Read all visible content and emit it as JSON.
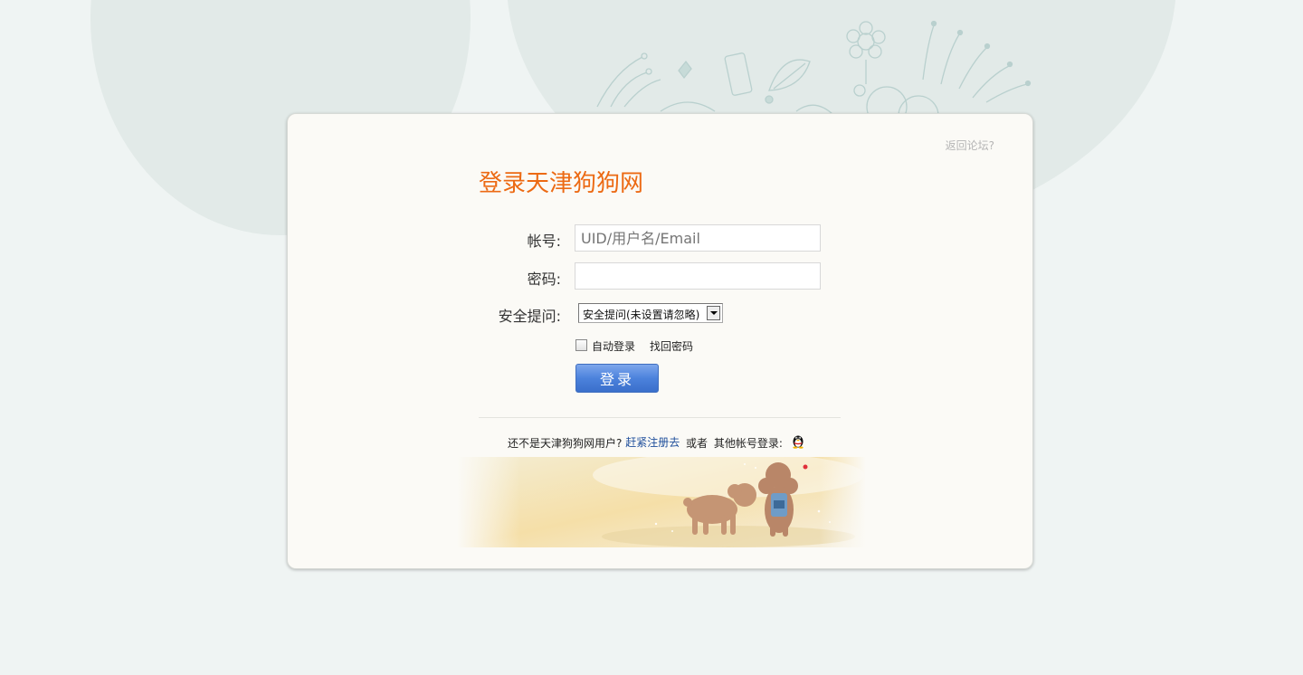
{
  "header": {
    "back_link": "返回论坛?"
  },
  "login": {
    "title": "登录天津狗狗网",
    "account_label": "帐号:",
    "account_placeholder": "UID/用户名/Email",
    "password_label": "密码:",
    "password_value": "",
    "security_label": "安全提问:",
    "security_selected": "安全提问(未设置请忽略)",
    "auto_login_label": "自动登录",
    "auto_login_checked": false,
    "forgot_password": "找回密码",
    "submit_label": "登录"
  },
  "register": {
    "prompt": "还不是天津狗狗网用户?",
    "link": "赶紧注册去",
    "or_text": "或者",
    "other_accounts": "其他帐号登录:",
    "qq_icon": "qq-penguin-icon"
  },
  "colors": {
    "title": "#ec6a14",
    "link": "#1e4e9b",
    "button": "#4c82dc",
    "page_bg": "#eff4f3",
    "card_bg": "#fbfaf6"
  }
}
